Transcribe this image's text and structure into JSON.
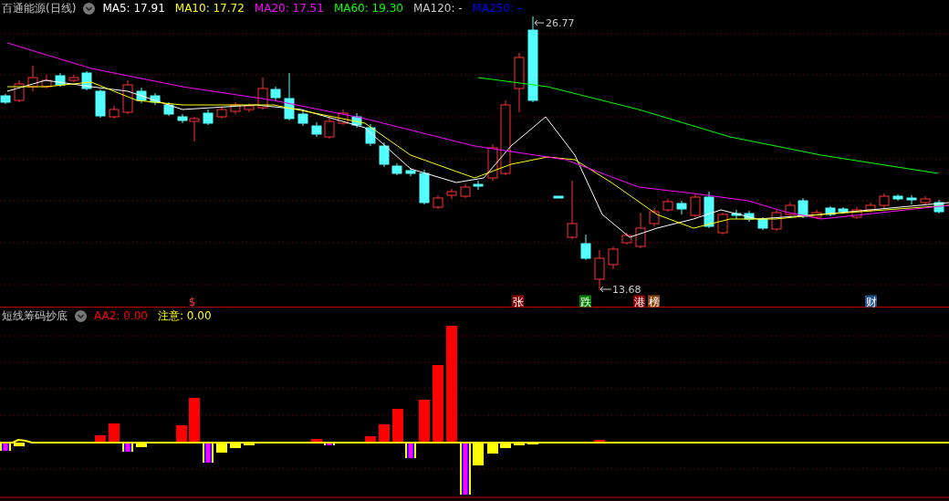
{
  "main_panel": {
    "title": "百通能源(日线)",
    "indicators": [
      {
        "label": "MA5:",
        "value": "17.91",
        "color": "#ffffff"
      },
      {
        "label": "MA10:",
        "value": "17.72",
        "color": "#ffff00"
      },
      {
        "label": "MA20:",
        "value": "17.51",
        "color": "#ff00ff"
      },
      {
        "label": "MA60:",
        "value": "19.30",
        "color": "#00ff00"
      },
      {
        "label": "MA120:",
        "value": "-",
        "color": "#c8c8c8"
      },
      {
        "label": "MA250:",
        "value": "-",
        "color": "#0000ff"
      }
    ],
    "high_label": "26.77",
    "low_label": "13.68",
    "markers": [
      {
        "text": "$",
        "color": "#000000"
      },
      {
        "text": "张",
        "color": "#8b0000"
      },
      {
        "text": "跌",
        "color": "#008000"
      },
      {
        "text": "港",
        "color": "#8b0000"
      },
      {
        "text": "榜",
        "color": "#8b4513"
      },
      {
        "text": "财",
        "color": "#1f4e8c"
      }
    ]
  },
  "sub_panel": {
    "title": "短线筹码抄底",
    "indicators": [
      {
        "label": "AA2:",
        "value": "0.00",
        "color": "#ff0000"
      },
      {
        "label": "注意:",
        "value": "0.00",
        "color": "#ffff00"
      }
    ]
  }
}
